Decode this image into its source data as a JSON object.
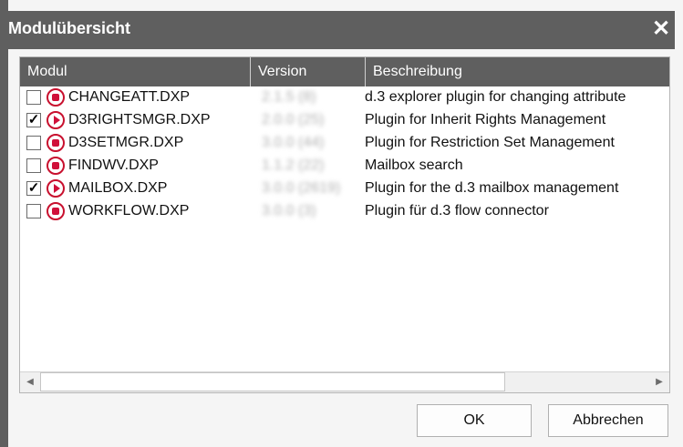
{
  "window": {
    "title": "Modulübersicht",
    "close_label": "✕"
  },
  "table": {
    "columns": [
      "Modul",
      "Version",
      "Beschreibung"
    ],
    "rows": [
      {
        "checked": false,
        "status": "stopped",
        "module": "CHANGEATT.DXP",
        "version": "2.1.5 (8)",
        "description": "d.3 explorer plugin for changing attribute"
      },
      {
        "checked": true,
        "status": "running",
        "module": "D3RIGHTSMGR.DXP",
        "version": "2.0.0 (25)",
        "description": "Plugin for Inherit Rights Management"
      },
      {
        "checked": false,
        "status": "stopped",
        "module": "D3SETMGR.DXP",
        "version": "3.0.0 (44)",
        "description": "Plugin for Restriction Set Management"
      },
      {
        "checked": false,
        "status": "stopped",
        "module": "FINDWV.DXP",
        "version": "1.1.2 (22)",
        "description": "Mailbox search"
      },
      {
        "checked": true,
        "status": "running",
        "module": "MAILBOX.DXP",
        "version": "3.0.0 (2619)",
        "description": "Plugin for the d.3 mailbox management"
      },
      {
        "checked": false,
        "status": "stopped",
        "module": "WORKFLOW.DXP",
        "version": "3.0.0 (3)",
        "description": "Plugin für d.3 flow connector"
      }
    ]
  },
  "scrollbar": {
    "left_arrow": "◀",
    "right_arrow": "▶"
  },
  "buttons": {
    "ok": "OK",
    "cancel": "Abbrechen"
  },
  "colors": {
    "titlebar": "#5f5f5f",
    "status_icon": "#d0103a"
  }
}
